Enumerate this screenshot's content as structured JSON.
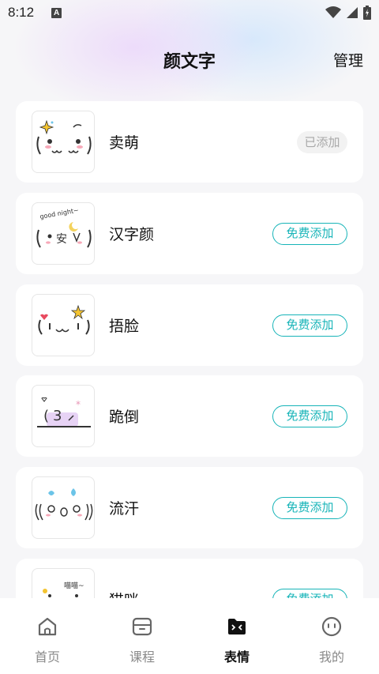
{
  "status_bar": {
    "time": "8:12",
    "notif_letter": "A"
  },
  "header": {
    "title": "颜文字",
    "manage_label": "管理"
  },
  "items": [
    {
      "title": "卖萌",
      "button": "已添加",
      "added": true,
      "thumb_icon": "cute-face-icon"
    },
    {
      "title": "汉字颜",
      "button": "免费添加",
      "added": false,
      "thumb_icon": "goodnight-face-icon"
    },
    {
      "title": "捂脸",
      "button": "免费添加",
      "added": false,
      "thumb_icon": "cover-face-icon"
    },
    {
      "title": "跪倒",
      "button": "免费添加",
      "added": false,
      "thumb_icon": "kneel-face-icon"
    },
    {
      "title": "流汗",
      "button": "免费添加",
      "added": false,
      "thumb_icon": "sweat-face-icon"
    },
    {
      "title": "猫咪",
      "button": "免费添加",
      "added": false,
      "thumb_icon": "cat-face-icon"
    }
  ],
  "nav": [
    {
      "label": "首页",
      "icon": "home-icon",
      "active": false
    },
    {
      "label": "课程",
      "icon": "course-box-icon",
      "active": false
    },
    {
      "label": "表情",
      "icon": "emoticon-folder-icon",
      "active": true
    },
    {
      "label": "我的",
      "icon": "profile-face-icon",
      "active": false
    }
  ],
  "colors": {
    "accent": "#17b4b8",
    "added_text": "#a8a8a8",
    "added_bg": "#f2f2f2"
  }
}
